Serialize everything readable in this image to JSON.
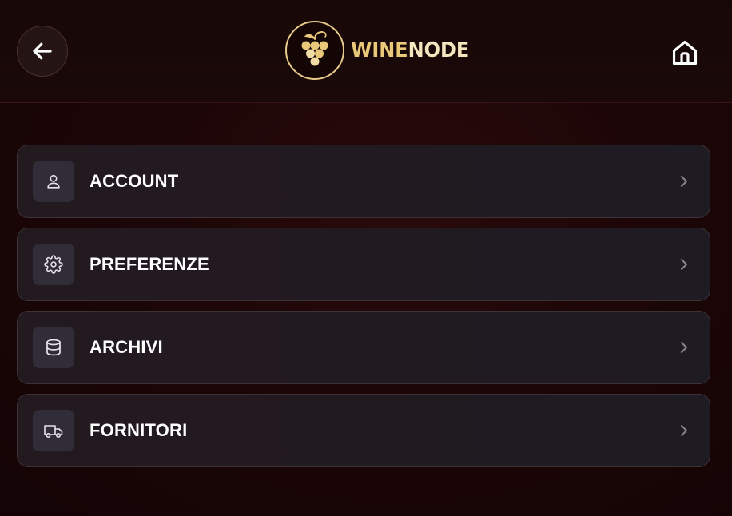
{
  "header": {
    "back_icon": "arrow-left-icon",
    "home_icon": "home-icon",
    "logo": {
      "text_part1": "WINE",
      "text_part2": "NODE",
      "icon": "grapes-icon"
    }
  },
  "menu": {
    "items": [
      {
        "label": "ACCOUNT",
        "icon": "user-icon"
      },
      {
        "label": "PREFERENZE",
        "icon": "gear-icon"
      },
      {
        "label": "ARCHIVI",
        "icon": "database-icon"
      },
      {
        "label": "FORNITORI",
        "icon": "truck-icon"
      }
    ]
  },
  "colors": {
    "background": "#1c0607",
    "header": "#170808",
    "card": "#221a20",
    "card_border": "#3c3238",
    "icon_tile": "#302d38",
    "logo_gold": "#e9c979",
    "logo_light": "#f5e6bf"
  }
}
